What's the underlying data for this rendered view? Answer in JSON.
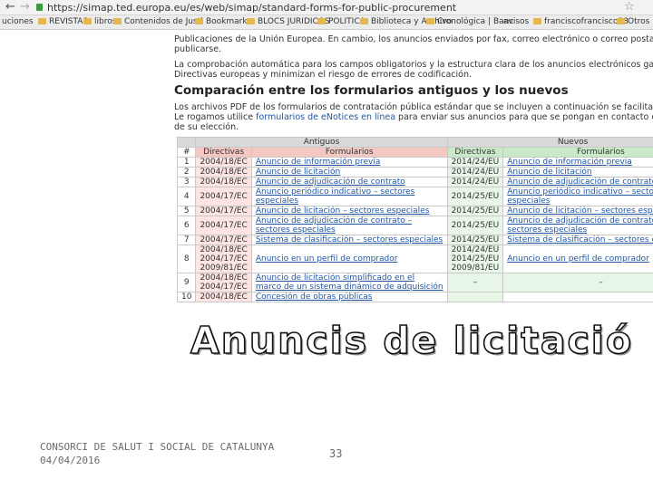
{
  "browser": {
    "url": "https://simap.ted.europa.eu/es/web/simap/standard-forms-for-public-procurement",
    "bookmarks": [
      "uciones",
      "REVISTAS",
      "libros",
      "Contenidos de Justi",
      "Bookmarks",
      "BLOCS JURIDICOS",
      "POLITICA",
      "Biblioteca y Archivo",
      "Cronológica | Banc",
      "avisos",
      "franciscofrancisco88",
      "Otros"
    ]
  },
  "page": {
    "para1_line1": "Publicaciones de la Unión Europea. En cambio, los anuncios enviados por fax, correo electrónico o correo postal pueden tardar hasta doce días",
    "para1_line2": "publicarse.",
    "para2_line1": "La comprobación automática para los campos obligatorios y la estructura clara de los anuncios electrónicos garantizan la coherencia con las",
    "para2_line2": "Directivas europeas y minimizan el riesgo de errores de codificación.",
    "section_title": "Comparación entre los formularios antiguos y los nuevos",
    "para3_line1": "Los archivos PDF de los formularios de contratación pública estándar que se incluyen a continuación se facilitan únicamente a modo de referenc",
    "para3_line2_pre": "Le rogamos utilice ",
    "para3_line2_link": "formularios de eNotices en línea",
    "para3_line2_post": " para enviar sus anuncios para que se pongan en contacto con un eSende",
    "para3_line3": "de su elección."
  },
  "table": {
    "group_old": "Antiguos",
    "group_new": "Nuevos",
    "col_num": "#",
    "col_dir": "Directivas",
    "col_form": "Formularios",
    "col_dir_new": "Directivas",
    "col_form_new": "Formularios",
    "rows": [
      {
        "n": "1",
        "dir_old": "2004/18/EC",
        "form_old": "Anuncio de información previa",
        "dir_new": "2014/24/EU",
        "form_new": "Anuncio de información previa"
      },
      {
        "n": "2",
        "dir_old": "2004/18/EC",
        "form_old": "Anuncio de licitación",
        "dir_new": "2014/24/EU",
        "form_new": "Anuncio de licitación"
      },
      {
        "n": "3",
        "dir_old": "2004/18/EC",
        "form_old": "Anuncio de adjudicación de contrato",
        "dir_new": "2014/24/EU",
        "form_new": "Anuncio de adjudicación de contrato"
      },
      {
        "n": "4",
        "dir_old": "2004/17/EC",
        "form_old": "Anuncio periódico indicativo – sectores",
        "form_old_2": "especiales",
        "dir_new": "2014/25/EU",
        "form_new": "Anuncio periódico indicativo – sectores",
        "form_new_2": "especiales"
      },
      {
        "n": "5",
        "dir_old": "2004/17/EC",
        "form_old": "Anuncio de licitación – sectores especiales",
        "dir_new": "2014/25/EU",
        "form_new": "Anuncio de licitación – sectores especiales"
      },
      {
        "n": "6",
        "dir_old": "2004/17/EC",
        "form_old": "Anuncio de adjudicación de contrato –",
        "form_old_2": "sectores especiales",
        "dir_new": "2014/25/EU",
        "form_new": "Anuncio de adjudicación de contrato –",
        "form_new_2": "sectores especiales"
      },
      {
        "n": "7",
        "dir_old": "2004/17/EC",
        "form_old": "Sistema de clasificación – sectores especiales",
        "dir_new": "2014/25/EU",
        "form_new": "Sistema de clasificación – sectores especiales"
      },
      {
        "n": "8",
        "dir_old": "2004/18/EC",
        "dir_old_2": "2004/17/EC",
        "dir_old_3": "2009/81/EC",
        "form_old": "Anuncio en un perfil de comprador",
        "dir_new": "2014/24/EU",
        "dir_new_2": "2014/25/EU",
        "dir_new_3": "2009/81/EU",
        "form_new": "Anuncio en un perfil de comprador"
      },
      {
        "n": "9",
        "dir_old": "2004/18/EC",
        "dir_old_2": "2004/17/EC",
        "form_old": "Anuncio de licitación simplificado en el",
        "form_old_2": "marco de un sistema dinámico de adquisición",
        "dir_new": "–",
        "form_new": "–"
      },
      {
        "n": "10",
        "dir_old": "2004/18/EC",
        "form_old": "Concesión de obras públicas",
        "dir_new": "",
        "form_new": ""
      }
    ]
  },
  "slide": {
    "title": "Anuncis de licitació",
    "footer_org": "CONSORCI DE SALUT I SOCIAL DE CATALUNYA",
    "footer_date": "04/04/2016",
    "page_number": "33"
  },
  "colors": {
    "old_header": "#f4c7c3",
    "new_header": "#c9eac9",
    "link": "#2156a5"
  }
}
